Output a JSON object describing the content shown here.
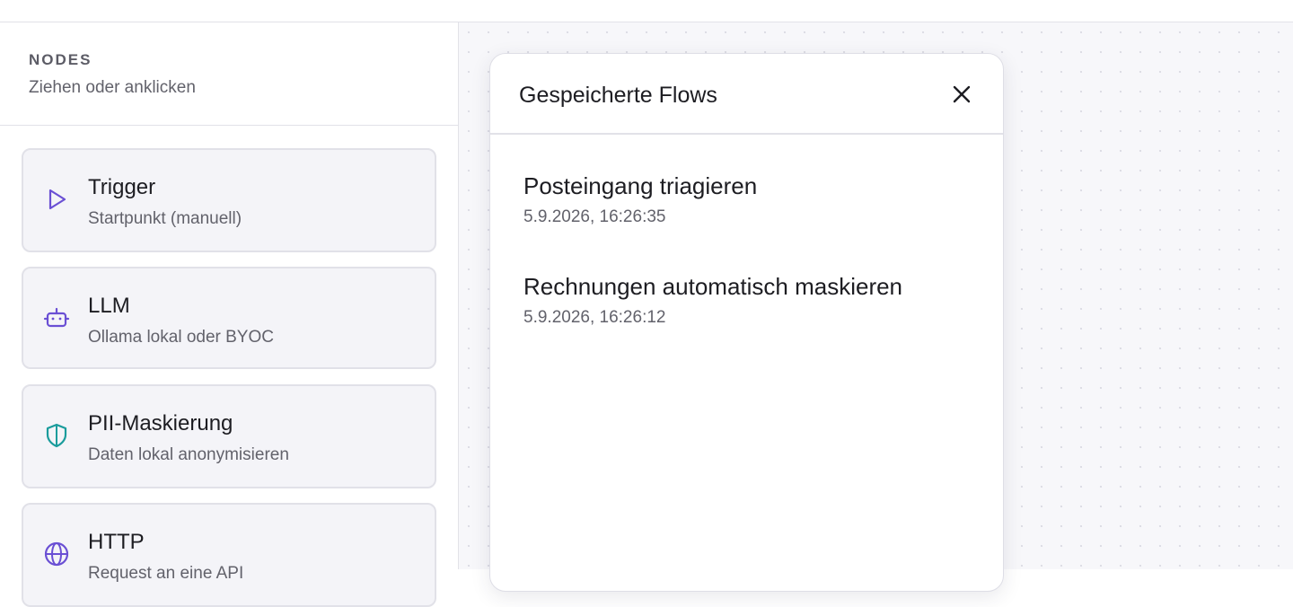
{
  "sidebar": {
    "title": "NODES",
    "subtitle": "Ziehen oder anklicken",
    "nodes": [
      {
        "title": "Trigger",
        "desc": "Startpunkt (manuell)",
        "icon": "play-icon",
        "icon_color": "#6a4fd4"
      },
      {
        "title": "LLM",
        "desc": "Ollama lokal oder BYOC",
        "icon": "robot-icon",
        "icon_color": "#6a4fd4"
      },
      {
        "title": "PII-Maskierung",
        "desc": "Daten lokal anonymisieren",
        "icon": "shield-icon",
        "icon_color": "#1a9c9c"
      },
      {
        "title": "HTTP",
        "desc": "Request an eine API",
        "icon": "globe-icon",
        "icon_color": "#6a4fd4"
      }
    ]
  },
  "modal": {
    "title": "Gespeicherte Flows",
    "flows": [
      {
        "name": "Posteingang triagieren",
        "date": "5.9.2026, 16:26:35"
      },
      {
        "name": "Rechnungen automatisch maskieren",
        "date": "5.9.2026, 16:26:12"
      }
    ]
  },
  "colors": {
    "accent": "#6a4fd4",
    "teal": "#1a9c9c",
    "card_bg": "#f4f4f8",
    "canvas_bg": "#f7f7fa"
  }
}
